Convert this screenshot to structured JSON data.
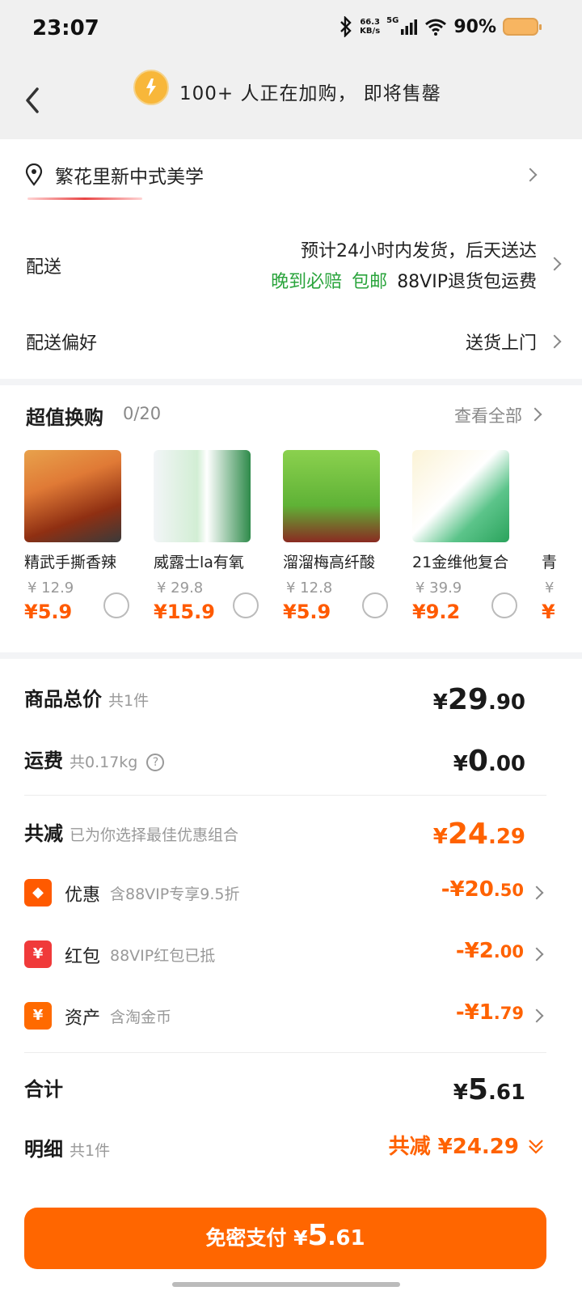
{
  "status_bar": {
    "time": "23:07",
    "net_speed_value": "66.3",
    "net_speed_unit": "KB/s",
    "signal_label": "5G",
    "battery": "90%"
  },
  "header": {
    "notice": "100+ 人正在加购， 即将售罄",
    "icon": "bell-icon"
  },
  "address": {
    "text": "繁花里新中式美学"
  },
  "delivery": {
    "label": "配送",
    "line1": "预计24小时内发货，后天送达",
    "tag_late": "晚到必赔",
    "tag_free": "包邮",
    "vip_note": "88VIP退货包运费"
  },
  "preference": {
    "label": "配送偏好",
    "value": "送货上门"
  },
  "bundle": {
    "title": "超值换购",
    "count": "0/20",
    "view_all": "查看全部",
    "items": [
      {
        "name": "精武手撕香辣",
        "orig": "¥ 12.9",
        "price": "¥5.9",
        "img_color": "#b74a1f"
      },
      {
        "name": "威露士la有氧",
        "orig": "¥ 29.8",
        "price": "¥15.9",
        "img_color": "#d9eef0"
      },
      {
        "name": "溜溜梅高纤酸",
        "orig": "¥ 12.8",
        "price": "¥5.9",
        "img_color": "#74c043"
      },
      {
        "name": "21金维他复合",
        "orig": "¥ 39.9",
        "price": "¥9.2",
        "img_color": "#e8f3e4"
      },
      {
        "name": "青",
        "orig": "¥",
        "price": "¥",
        "img_color": "#f1f1f1"
      }
    ]
  },
  "summary": {
    "goods_total": {
      "label": "商品总价",
      "sub": "共1件",
      "yen": "¥",
      "int": "29",
      "dec": ".90"
    },
    "shipping": {
      "label": "运费",
      "sub": "共0.17kg",
      "yen": "¥",
      "int": "0",
      "dec": ".00"
    },
    "total_off": {
      "label": "共减",
      "sub": "已为你选择最佳优惠组合",
      "yen": "¥",
      "int": "24",
      "dec": ".29"
    },
    "discounts": [
      {
        "label": "优惠",
        "sub": "含88VIP专享9.5折",
        "int": "-¥20",
        "dec": ".50",
        "icon": "tag-icon",
        "icon_color": "#ff5a00",
        "glyph": "◆"
      },
      {
        "label": "红包",
        "sub": "88VIP红包已抵",
        "int": "-¥2",
        "dec": ".00",
        "icon": "red-packet-icon",
        "icon_color": "#f03a3a",
        "glyph": "¥"
      },
      {
        "label": "资产",
        "sub": "含淘金币",
        "int": "-¥1",
        "dec": ".79",
        "icon": "coin-icon",
        "icon_color": "#ff6a00",
        "glyph": "¥"
      }
    ],
    "grand_total": {
      "label": "合计",
      "yen": "¥",
      "int": "5",
      "dec": ".61"
    },
    "detail": {
      "label": "明细",
      "sub": "共1件",
      "off_label": "共减 ¥24.29"
    }
  },
  "pay_button": {
    "prefix": "免密支付 ¥",
    "int": "5",
    "dec": ".61"
  },
  "colors": {
    "accent": "#ff6200",
    "green": "#2aa43c"
  }
}
